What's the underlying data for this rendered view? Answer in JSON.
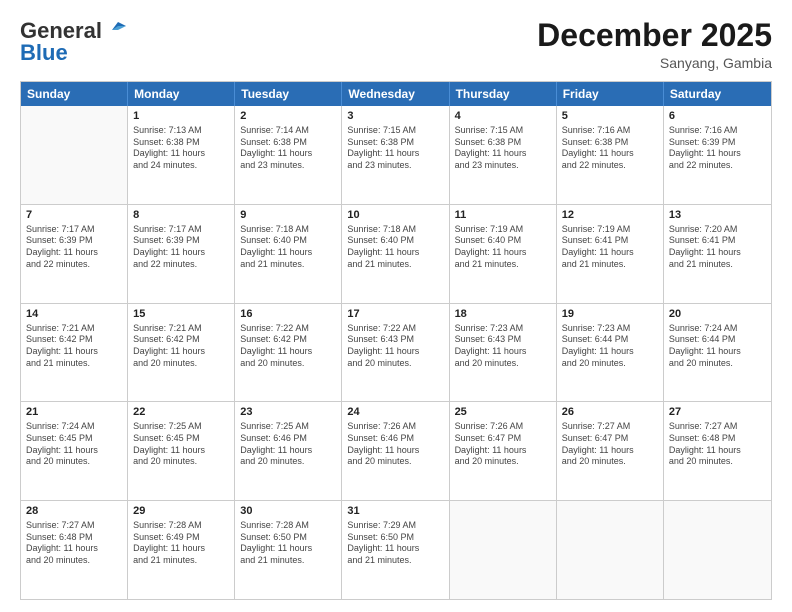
{
  "logo": {
    "line1": "General",
    "line2": "Blue"
  },
  "header": {
    "month": "December 2025",
    "location": "Sanyang, Gambia"
  },
  "days": [
    "Sunday",
    "Monday",
    "Tuesday",
    "Wednesday",
    "Thursday",
    "Friday",
    "Saturday"
  ],
  "weeks": [
    [
      {
        "day": "",
        "info": ""
      },
      {
        "day": "1",
        "info": "Sunrise: 7:13 AM\nSunset: 6:38 PM\nDaylight: 11 hours\nand 24 minutes."
      },
      {
        "day": "2",
        "info": "Sunrise: 7:14 AM\nSunset: 6:38 PM\nDaylight: 11 hours\nand 23 minutes."
      },
      {
        "day": "3",
        "info": "Sunrise: 7:15 AM\nSunset: 6:38 PM\nDaylight: 11 hours\nand 23 minutes."
      },
      {
        "day": "4",
        "info": "Sunrise: 7:15 AM\nSunset: 6:38 PM\nDaylight: 11 hours\nand 23 minutes."
      },
      {
        "day": "5",
        "info": "Sunrise: 7:16 AM\nSunset: 6:38 PM\nDaylight: 11 hours\nand 22 minutes."
      },
      {
        "day": "6",
        "info": "Sunrise: 7:16 AM\nSunset: 6:39 PM\nDaylight: 11 hours\nand 22 minutes."
      }
    ],
    [
      {
        "day": "7",
        "info": "Sunrise: 7:17 AM\nSunset: 6:39 PM\nDaylight: 11 hours\nand 22 minutes."
      },
      {
        "day": "8",
        "info": "Sunrise: 7:17 AM\nSunset: 6:39 PM\nDaylight: 11 hours\nand 22 minutes."
      },
      {
        "day": "9",
        "info": "Sunrise: 7:18 AM\nSunset: 6:40 PM\nDaylight: 11 hours\nand 21 minutes."
      },
      {
        "day": "10",
        "info": "Sunrise: 7:18 AM\nSunset: 6:40 PM\nDaylight: 11 hours\nand 21 minutes."
      },
      {
        "day": "11",
        "info": "Sunrise: 7:19 AM\nSunset: 6:40 PM\nDaylight: 11 hours\nand 21 minutes."
      },
      {
        "day": "12",
        "info": "Sunrise: 7:19 AM\nSunset: 6:41 PM\nDaylight: 11 hours\nand 21 minutes."
      },
      {
        "day": "13",
        "info": "Sunrise: 7:20 AM\nSunset: 6:41 PM\nDaylight: 11 hours\nand 21 minutes."
      }
    ],
    [
      {
        "day": "14",
        "info": "Sunrise: 7:21 AM\nSunset: 6:42 PM\nDaylight: 11 hours\nand 21 minutes."
      },
      {
        "day": "15",
        "info": "Sunrise: 7:21 AM\nSunset: 6:42 PM\nDaylight: 11 hours\nand 20 minutes."
      },
      {
        "day": "16",
        "info": "Sunrise: 7:22 AM\nSunset: 6:42 PM\nDaylight: 11 hours\nand 20 minutes."
      },
      {
        "day": "17",
        "info": "Sunrise: 7:22 AM\nSunset: 6:43 PM\nDaylight: 11 hours\nand 20 minutes."
      },
      {
        "day": "18",
        "info": "Sunrise: 7:23 AM\nSunset: 6:43 PM\nDaylight: 11 hours\nand 20 minutes."
      },
      {
        "day": "19",
        "info": "Sunrise: 7:23 AM\nSunset: 6:44 PM\nDaylight: 11 hours\nand 20 minutes."
      },
      {
        "day": "20",
        "info": "Sunrise: 7:24 AM\nSunset: 6:44 PM\nDaylight: 11 hours\nand 20 minutes."
      }
    ],
    [
      {
        "day": "21",
        "info": "Sunrise: 7:24 AM\nSunset: 6:45 PM\nDaylight: 11 hours\nand 20 minutes."
      },
      {
        "day": "22",
        "info": "Sunrise: 7:25 AM\nSunset: 6:45 PM\nDaylight: 11 hours\nand 20 minutes."
      },
      {
        "day": "23",
        "info": "Sunrise: 7:25 AM\nSunset: 6:46 PM\nDaylight: 11 hours\nand 20 minutes."
      },
      {
        "day": "24",
        "info": "Sunrise: 7:26 AM\nSunset: 6:46 PM\nDaylight: 11 hours\nand 20 minutes."
      },
      {
        "day": "25",
        "info": "Sunrise: 7:26 AM\nSunset: 6:47 PM\nDaylight: 11 hours\nand 20 minutes."
      },
      {
        "day": "26",
        "info": "Sunrise: 7:27 AM\nSunset: 6:47 PM\nDaylight: 11 hours\nand 20 minutes."
      },
      {
        "day": "27",
        "info": "Sunrise: 7:27 AM\nSunset: 6:48 PM\nDaylight: 11 hours\nand 20 minutes."
      }
    ],
    [
      {
        "day": "28",
        "info": "Sunrise: 7:27 AM\nSunset: 6:48 PM\nDaylight: 11 hours\nand 20 minutes."
      },
      {
        "day": "29",
        "info": "Sunrise: 7:28 AM\nSunset: 6:49 PM\nDaylight: 11 hours\nand 21 minutes."
      },
      {
        "day": "30",
        "info": "Sunrise: 7:28 AM\nSunset: 6:50 PM\nDaylight: 11 hours\nand 21 minutes."
      },
      {
        "day": "31",
        "info": "Sunrise: 7:29 AM\nSunset: 6:50 PM\nDaylight: 11 hours\nand 21 minutes."
      },
      {
        "day": "",
        "info": ""
      },
      {
        "day": "",
        "info": ""
      },
      {
        "day": "",
        "info": ""
      }
    ]
  ]
}
